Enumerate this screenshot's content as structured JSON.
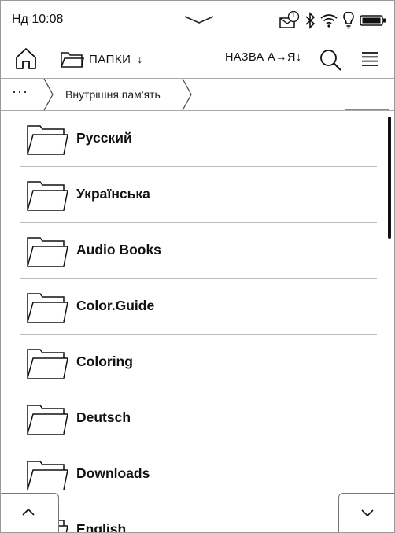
{
  "status_bar": {
    "time": "Нд 10:08",
    "notification_count": "1",
    "icons": [
      "mail-icon",
      "bluetooth-icon",
      "wifi-icon",
      "frontlight-icon",
      "battery-icon"
    ]
  },
  "toolbar": {
    "folders_label": "ПАПКИ",
    "folders_arrow": "↓",
    "sort_label": "НАЗВА А→Я↓"
  },
  "breadcrumb": {
    "more": "···",
    "location": "Внутрішня пам'ять"
  },
  "folders": [
    {
      "name": "Русский"
    },
    {
      "name": "Українська"
    },
    {
      "name": "Audio Books"
    },
    {
      "name": "Color.Guide"
    },
    {
      "name": "Coloring"
    },
    {
      "name": "Deutsch"
    },
    {
      "name": "Downloads"
    },
    {
      "name": "English"
    }
  ],
  "scroll": {
    "position_fraction": 0.0,
    "visible_fraction": 0.28
  },
  "colors": {
    "ink": "#111111",
    "divider": "#bdbdbd",
    "border": "#9a9a9a",
    "background": "#ffffff"
  }
}
